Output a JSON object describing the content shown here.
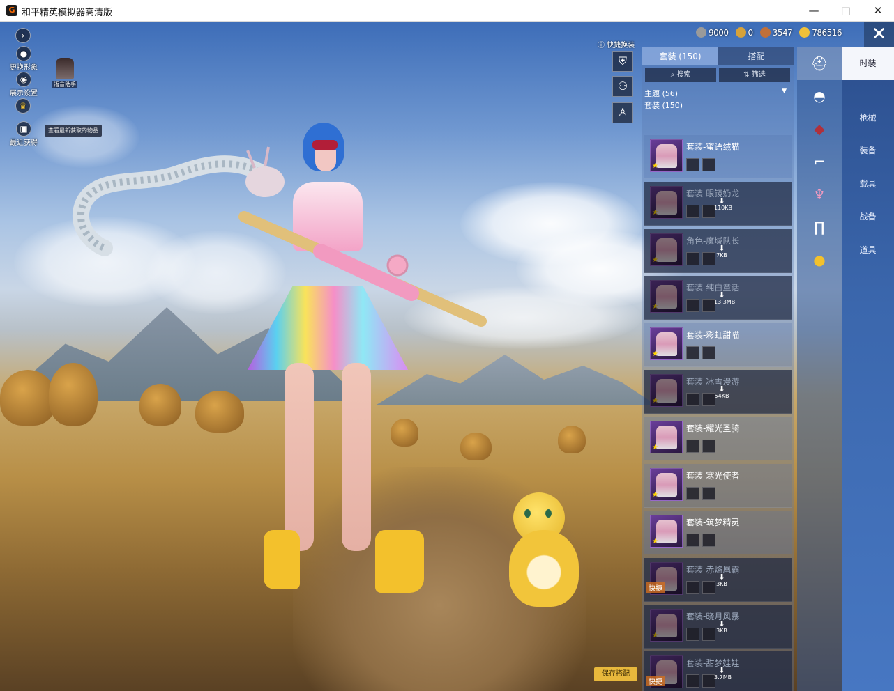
{
  "window": {
    "title": "和平精英模拟器高清版",
    "minimize": "—",
    "maximize": "□",
    "close": "✕"
  },
  "left_menu": {
    "change_look": "更换形象",
    "display_settings": "展示设置",
    "recent": "最近获得",
    "voice_assistant": "语音助手",
    "recent_tooltip": "查看最新获取的物品"
  },
  "currencies": [
    {
      "value": "9000",
      "color": "#9a9a9a"
    },
    {
      "value": "0",
      "color": "#d7a23a"
    },
    {
      "value": "3547",
      "color": "#c0703a"
    },
    {
      "value": "786516",
      "color": "#f0c13a"
    }
  ],
  "quick_change_label": "快捷换装",
  "categories": [
    {
      "label": "时装",
      "active": true
    },
    {
      "label": "枪械",
      "active": false
    },
    {
      "label": "装备",
      "active": false
    },
    {
      "label": "载具",
      "active": false
    },
    {
      "label": "战备",
      "active": false
    },
    {
      "label": "道具",
      "active": false
    }
  ],
  "panel": {
    "tab_suits": "套装 (150)",
    "tab_match": "搭配",
    "search": "搜索",
    "filter": "筛选",
    "theme": "主题 (56)",
    "suits": "套装 (150)"
  },
  "suits": [
    {
      "name": "套装-蜜语绒猫",
      "downloaded": true,
      "size": ""
    },
    {
      "name": "套装-眼镜奶龙",
      "downloaded": false,
      "size": "110KB"
    },
    {
      "name": "角色-魔域队长",
      "downloaded": false,
      "size": "7KB"
    },
    {
      "name": "套装-纯白童话",
      "downloaded": false,
      "size": "13.3MB"
    },
    {
      "name": "套装-彩虹甜喵",
      "downloaded": true,
      "size": ""
    },
    {
      "name": "套装-冰雪漫游",
      "downloaded": false,
      "size": "54KB"
    },
    {
      "name": "套装-耀光圣骑",
      "downloaded": true,
      "size": ""
    },
    {
      "name": "套装-寒光使者",
      "downloaded": true,
      "size": ""
    },
    {
      "name": "套装-筑梦精灵",
      "downloaded": true,
      "size": ""
    },
    {
      "name": "套装-赤焰凰霸",
      "downloaded": false,
      "size": "3KB"
    },
    {
      "name": "套装-晓月风暴",
      "downloaded": false,
      "size": "3KB"
    },
    {
      "name": "套装-甜梦娃娃",
      "downloaded": false,
      "size": "3.7MB"
    }
  ],
  "quick_tag": "快捷",
  "save_button": "保存搭配"
}
